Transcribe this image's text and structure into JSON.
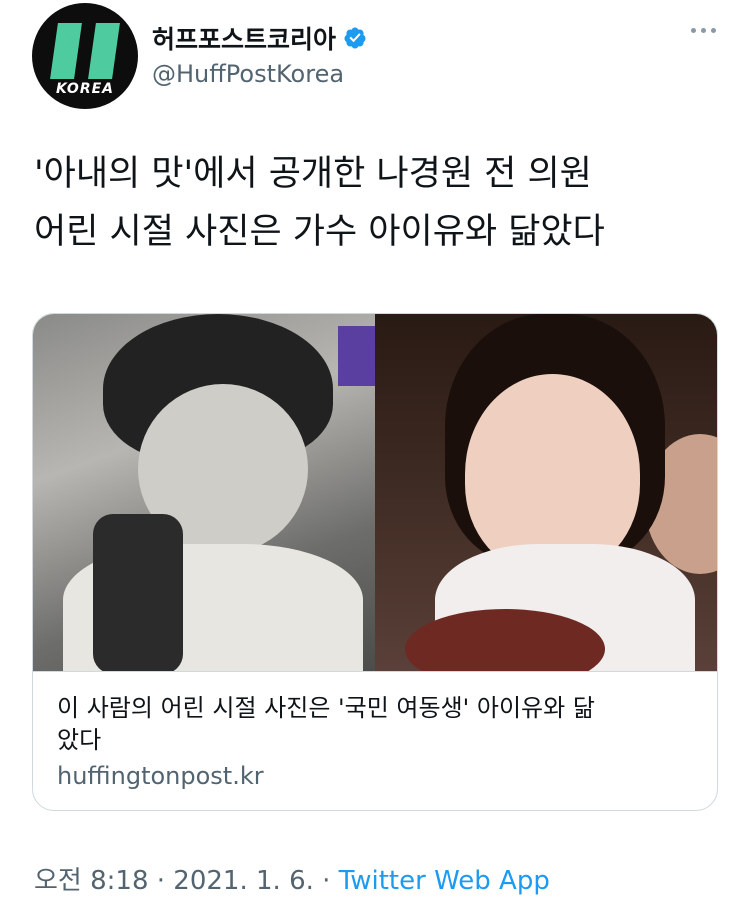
{
  "author": {
    "avatar_text": "KOREA",
    "display_name": "허프포스트코리아",
    "handle": "@HuffPostKorea",
    "verified_icon": "verified-badge-icon"
  },
  "tweet": {
    "text_line1": "'아내의 맛'에서 공개한 나경원 전 의원",
    "text_line2": "어린 시절 사진은 가수 아이유와 닮았다"
  },
  "card": {
    "title_line1": "이 사람의 어린 시절 사진은 '국민 여동생' 아이유와 닮",
    "title_line2": "았다",
    "domain": "huffingtonpost.kr"
  },
  "meta": {
    "time": "오전 8:18",
    "separator1": " · ",
    "date": "2021. 1. 6.",
    "separator2": " · ",
    "app": "Twitter Web App"
  },
  "colors": {
    "accent": "#1d9bf0",
    "secondary_text": "#536471",
    "brand_green": "#4fcc9f"
  }
}
